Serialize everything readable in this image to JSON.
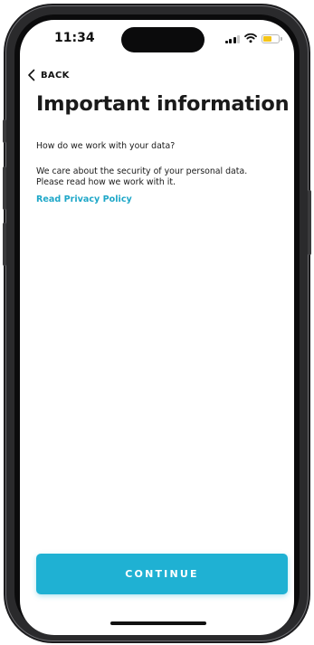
{
  "status_bar": {
    "time": "11:34",
    "icons": [
      "signal-icon",
      "wifi-icon",
      "battery-icon"
    ],
    "battery_color": "#f5c518"
  },
  "nav": {
    "back_label": "BACK",
    "back_icon": "chevron-left-icon"
  },
  "page": {
    "title": "Important information",
    "question": "How do we work with your data?",
    "paragraph_line1": "We care about the security of your personal data.",
    "paragraph_line2": "Please read how we work with it.",
    "privacy_link": "Read Privacy Policy"
  },
  "actions": {
    "continue_label": "CONTINUE"
  },
  "colors": {
    "accent": "#1fb1d3",
    "link": "#1ea7c8",
    "text": "#1a1a1a"
  }
}
